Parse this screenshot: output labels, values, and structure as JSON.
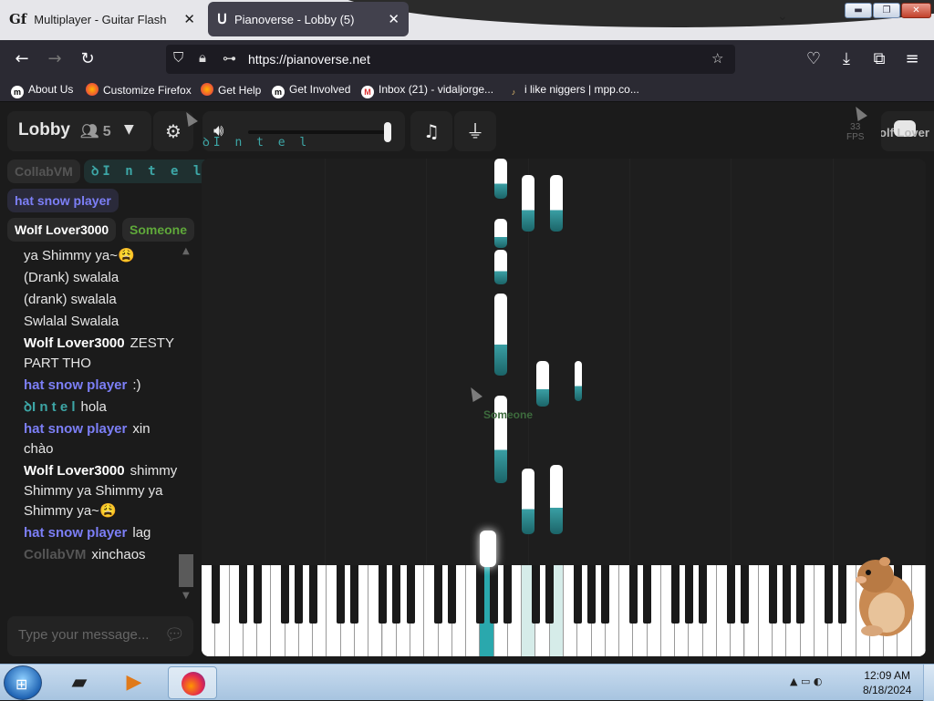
{
  "browser": {
    "tabs": [
      {
        "title": "Multiplayer - Guitar Flash",
        "icon": "Gf",
        "close": "✕"
      },
      {
        "title": "Pianoverse - Lobby (5)",
        "icon": "ᑌ",
        "close": "✕"
      }
    ],
    "tab_list_icon": "⌄",
    "window_buttons": {
      "minimize": "▬",
      "maximize": "❐",
      "close": "✕"
    },
    "url": "https://pianoverse.net",
    "bookmarks": [
      {
        "label": "About Us",
        "icon": "m"
      },
      {
        "label": "Customize Firefox",
        "icon": "firefox-icon"
      },
      {
        "label": "Get Help",
        "icon": "firefox-icon"
      },
      {
        "label": "Get Involved",
        "icon": "m"
      },
      {
        "label": "Inbox (21) - vidaljorge...",
        "icon": "M"
      },
      {
        "label": "i like niggers | mpp.co...",
        "icon": "♪"
      }
    ]
  },
  "app": {
    "room_name": "Lobby",
    "user_count": "5",
    "volume_user_label": "ꝺI n t e l",
    "fps_label": "33\nFPS",
    "discord_label": "Wolf Lover",
    "cursor_labels": [
      "Someone"
    ],
    "users": [
      {
        "name": "CollabVM",
        "color": "#555555"
      },
      {
        "name": "ꝺI n t e l",
        "color": "#3da6a6"
      },
      {
        "name": "hat snow player",
        "color": "#7c7ff7"
      },
      {
        "name": "Wolf Lover3000",
        "color": "#ffffff"
      },
      {
        "name": "Someone",
        "color": "#5fa83a"
      }
    ],
    "chat": [
      {
        "name": "",
        "text": "ya Shimmy ya~😩"
      },
      {
        "name": "",
        "text": "(Drank) swalala"
      },
      {
        "name": "",
        "text": "(drank) swalala"
      },
      {
        "name": "",
        "text": "Swlalal Swalala"
      },
      {
        "name": "Wolf Lover3000",
        "text": "ZESTY PART THO",
        "color": "#ffffff"
      },
      {
        "name": "hat snow player",
        "text": ":)",
        "color": "#7c7ff7"
      },
      {
        "name": "ꝺI n t e l",
        "text": "hola",
        "color": "#3da6a6"
      },
      {
        "name": "hat snow player",
        "text": "xin chào",
        "color": "#7c7ff7"
      },
      {
        "name": "Wolf Lover3000",
        "text": "shimmy Shimmy ya Shimmy ya Shimmy ya~😩",
        "color": "#ffffff"
      },
      {
        "name": "hat snow player",
        "text": "lag",
        "color": "#7c7ff7"
      },
      {
        "name": "CollabVM",
        "text": "xinchaos",
        "color": "#555555"
      }
    ],
    "chat_placeholder": "Type your message...",
    "volume_level": 0.97
  },
  "taskbar": {
    "time": "12:09 AM",
    "date": "8/18/2024",
    "tray_icons": "▲ ▭ ◐"
  }
}
